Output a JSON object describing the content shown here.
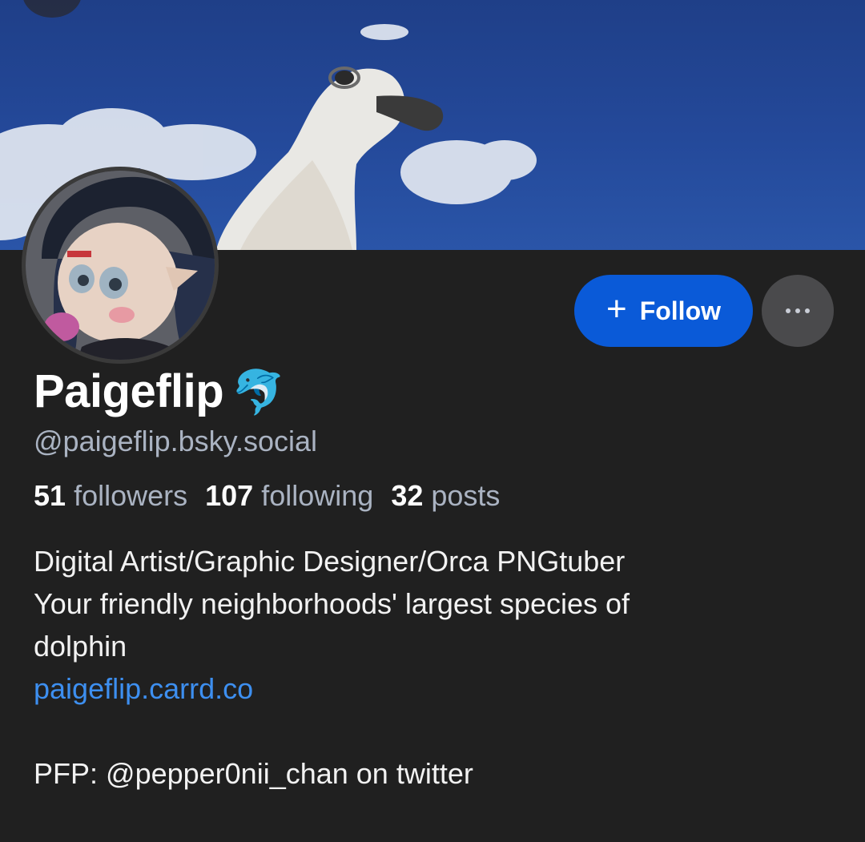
{
  "profile": {
    "display_name": "Paigeflip",
    "name_emoji": "🐬",
    "handle": "@paigeflip.bsky.social",
    "stats": {
      "followers_count": "51",
      "followers_label": "followers",
      "following_count": "107",
      "following_label": "following",
      "posts_count": "32",
      "posts_label": "posts"
    },
    "bio": {
      "line1": "Digital Artist/Graphic Designer/Orca PNGtuber",
      "line2": "Your friendly neighborhoods' largest species of",
      "line3": "dolphin",
      "link": "paigeflip.carrd.co",
      "line5": "PFP: @pepper0nii_chan on twitter"
    }
  },
  "actions": {
    "follow_icon": "+",
    "follow_label": "Follow",
    "more_icon": "ellipsis-icon"
  },
  "colors": {
    "background": "#202020",
    "follow_button": "#0a5ad8",
    "link": "#3d8ff0",
    "secondary_text": "#aab3c2"
  }
}
